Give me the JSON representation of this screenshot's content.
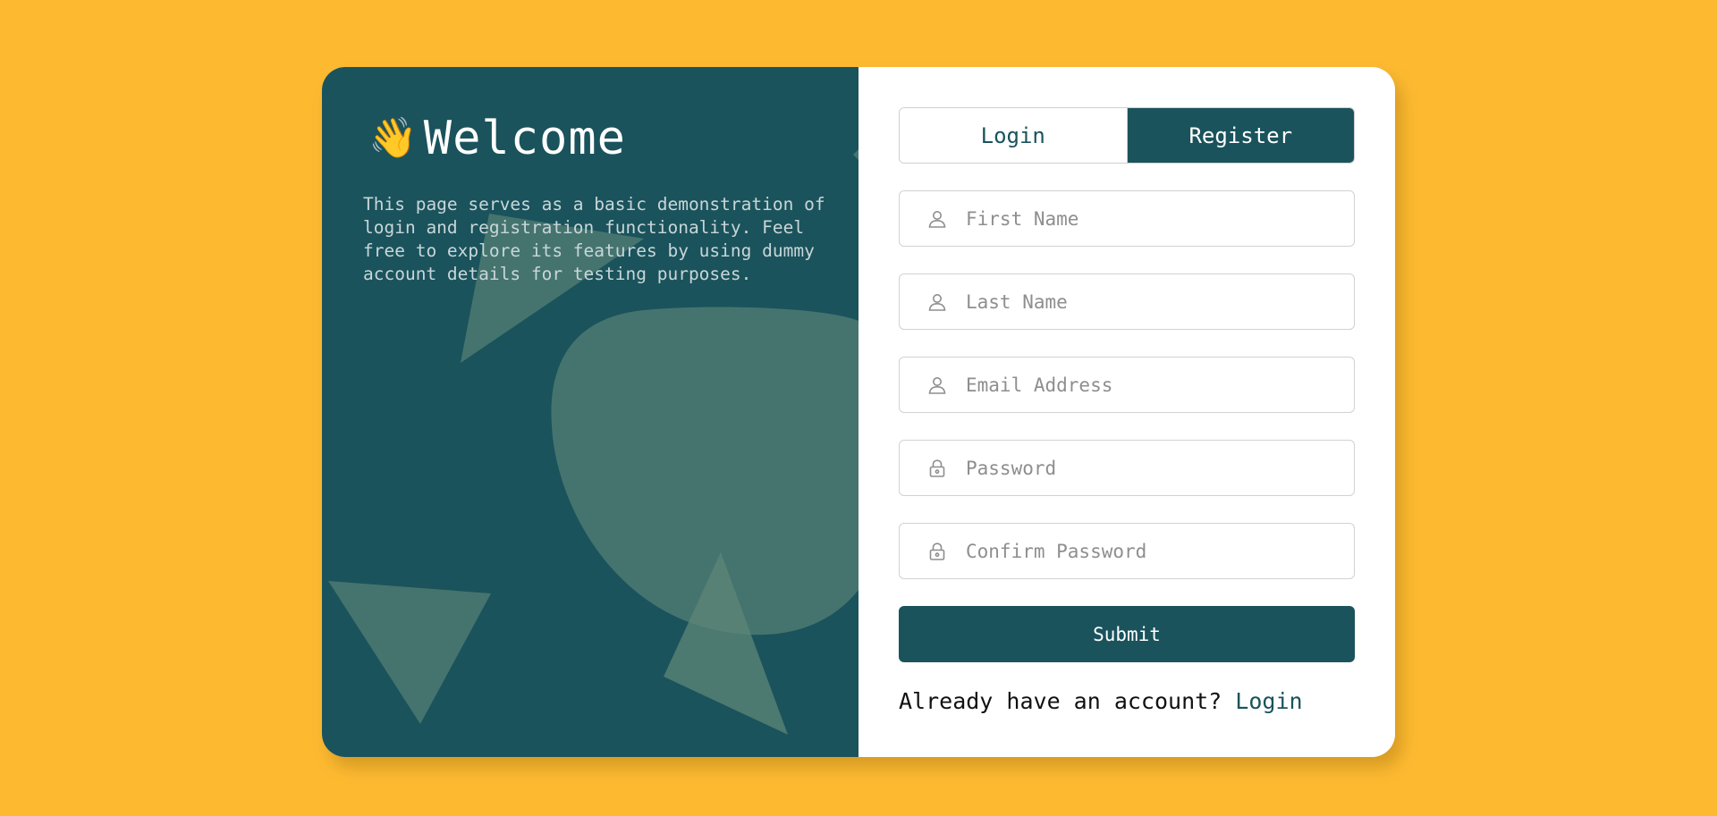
{
  "colors": {
    "background": "#FDBA31",
    "primary": "#1A535C",
    "panel_text": "#C9D6D8",
    "shape": "#4E7A72"
  },
  "welcome": {
    "emoji": "👋",
    "title": "Welcome",
    "description": "This page serves as a basic demonstration of login and registration functionality. Feel free to explore its features by using dummy account details for testing purposes."
  },
  "tabs": {
    "login_label": "Login",
    "register_label": "Register",
    "active": "Register"
  },
  "fields": {
    "first_name": {
      "placeholder": "First Name",
      "value": "",
      "icon": "user-icon"
    },
    "last_name": {
      "placeholder": "Last Name",
      "value": "",
      "icon": "user-icon"
    },
    "email": {
      "placeholder": "Email Address",
      "value": "",
      "icon": "user-icon"
    },
    "password": {
      "placeholder": "Password",
      "value": "",
      "icon": "lock-icon"
    },
    "confirm_password": {
      "placeholder": "Confirm Password",
      "value": "",
      "icon": "lock-icon"
    }
  },
  "submit_label": "Submit",
  "footer": {
    "prompt": "Already have an account?",
    "link_label": "Login"
  }
}
